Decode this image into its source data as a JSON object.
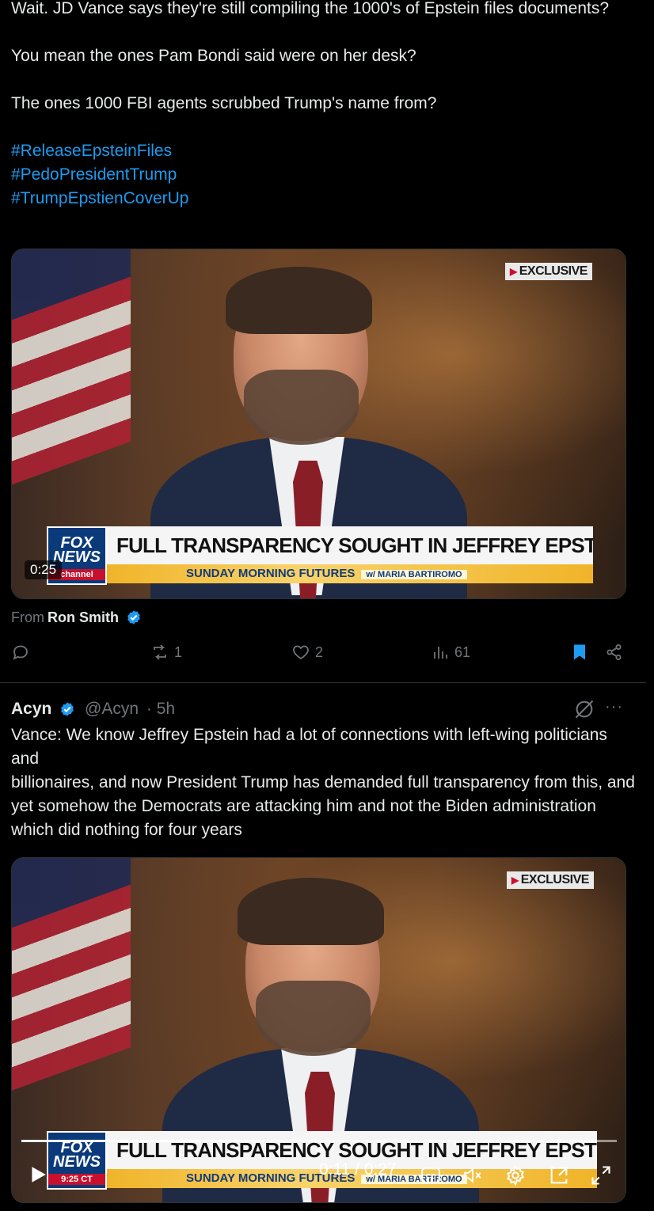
{
  "tweet1": {
    "paragraphs": [
      "Wait. JD Vance says they're still compiling the 1000's of Epstein files documents?",
      "You mean the ones Pam Bondi said were on her desk?",
      "The ones 1000 FBI agents scrubbed Trump's name from?"
    ],
    "hashtags": [
      "#ReleaseEpsteinFiles",
      "#PedoPresidentTrump",
      "#TrumpEpstienCoverUp"
    ],
    "video": {
      "badge": "EXCLUSIVE",
      "fox_logo": "FOX NEWS",
      "fox_sub": "channel",
      "headline": "FULL TRANSPARENCY SOUGHT IN JEFFREY EPSTEIN CASE",
      "show": "SUNDAY MORNING FUTURES",
      "host": "w/ MARIA BARTIROMO",
      "timestamp": "0:25"
    },
    "from_label": "From",
    "from_name": "Ron Smith",
    "actions": {
      "reply_icon": "reply-icon",
      "retweets": "1",
      "likes": "2",
      "views": "61"
    }
  },
  "tweet2": {
    "name": "Acyn",
    "handle": "@Acyn",
    "time": "· 5h",
    "more": "···",
    "lines": [
      "Vance: We know Jeffrey Epstein had a lot of connections with left-wing politicians and",
      "billionaires, and now President Trump has demanded full transparency from this, and yet somehow the Democrats are attacking him and not the Biden administration which did nothing for four years"
    ],
    "video": {
      "badge": "EXCLUSIVE",
      "fox_logo": "FOX NEWS",
      "fox_sub": "9:25 CT",
      "headline": "FULL TRANSPARENCY SOUGHT IN JEFFREY EPSTEIN CASE",
      "show": "SUNDAY MORNING FUTURES",
      "host": "w/ MARIA BARTIROMO",
      "time_readout": "0:11 / 0:27",
      "progress": 0.41
    }
  },
  "colors": {
    "accent": "#1d9bf0",
    "muted": "#71767b",
    "text": "#e7e9ea",
    "background": "#000000"
  }
}
